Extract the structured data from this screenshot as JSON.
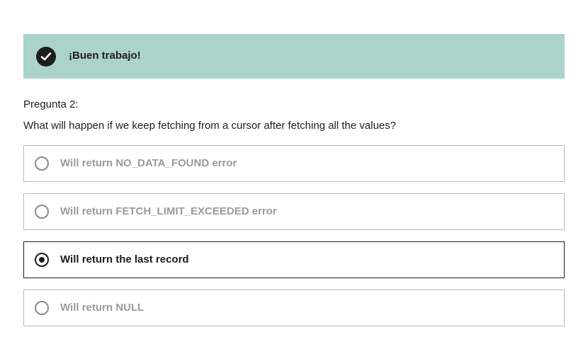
{
  "feedback": {
    "icon": "check-circle-icon",
    "message": "¡Buen trabajo!",
    "background_color": "#acd2cc"
  },
  "question": {
    "number_label": "Pregunta 2:",
    "text": "What will happen if we keep fetching from a cursor after fetching all the values?"
  },
  "options": [
    {
      "label": "Will return NO_DATA_FOUND error",
      "selected": false
    },
    {
      "label": "Will return FETCH_LIMIT_EXCEEDED error",
      "selected": false
    },
    {
      "label": "Will return the last record",
      "selected": true
    },
    {
      "label": "Will return NULL",
      "selected": false
    }
  ]
}
